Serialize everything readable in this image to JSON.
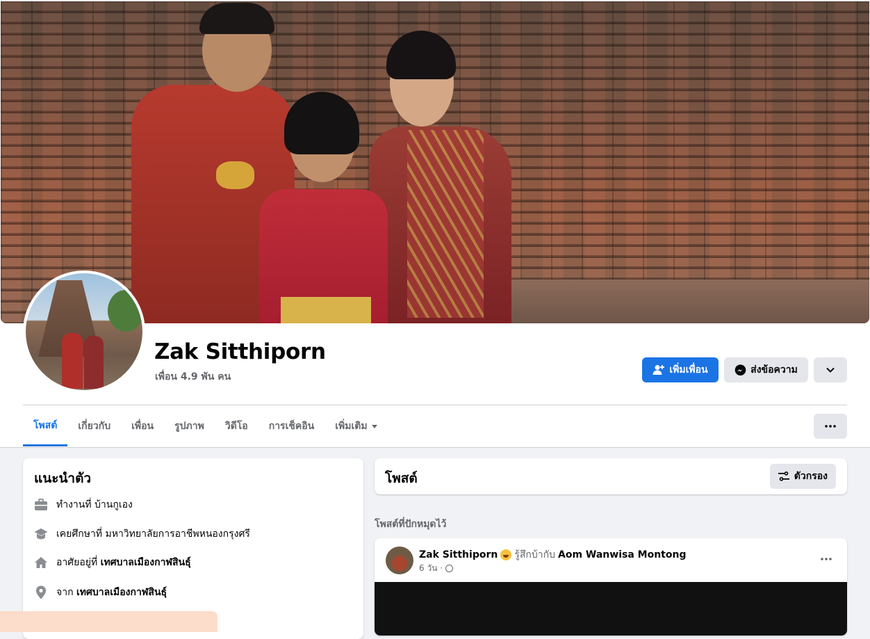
{
  "profile": {
    "name": "Zak Sitthiporn",
    "friends": "เพื่อน 4.9 พัน คน"
  },
  "actions": {
    "add_friend": "เพิ่มเพื่อน",
    "message": "ส่งข้อความ"
  },
  "tabs": [
    {
      "label": "โพสต์",
      "active": true
    },
    {
      "label": "เกี่ยวกับ"
    },
    {
      "label": "เพื่อน"
    },
    {
      "label": "รูปภาพ"
    },
    {
      "label": "วิดีโอ"
    },
    {
      "label": "การเช็คอิน"
    },
    {
      "label": "เพิ่มเติม"
    }
  ],
  "intro": {
    "title": "แนะนำตัว",
    "items": [
      {
        "icon": "briefcase-icon",
        "text": "ทำงานที่ บ้านกูเอง",
        "bold": ""
      },
      {
        "icon": "graduation-cap-icon",
        "text": "เคยศึกษาที่ มหาวิทยาลัยการอาชีพหนองกรุงศรี",
        "bold": ""
      },
      {
        "icon": "home-icon",
        "text": "อาศัยอยู่ที่ ",
        "bold": "เทศบาลเมืองกาฬสินธุ์"
      },
      {
        "icon": "location-pin-icon",
        "text": "จาก ",
        "bold": "เทศบาลเมืองกาฬสินธุ์"
      }
    ]
  },
  "posts": {
    "title": "โพสต์",
    "filter": "ตัวกรอง",
    "pinned_label": "โพสต์ที่ปักหมุดไว้"
  },
  "post": {
    "author": "Zak Sitthiporn",
    "feeling": "รู้สึกบ้ากับ",
    "tagged": "Aom Wanwisa Montong",
    "time": "6 วัน ·"
  },
  "colors": {
    "accent": "#1b74e4",
    "background": "#f0f2f5",
    "secondary_text": "#65676b"
  }
}
